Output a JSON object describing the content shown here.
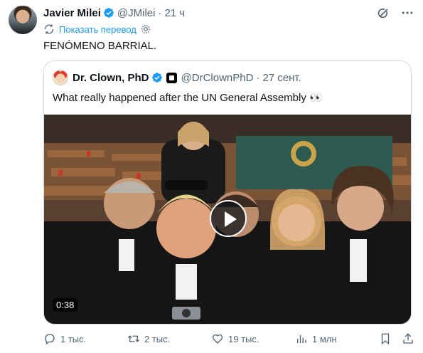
{
  "tweet": {
    "author": {
      "name": "Javier Milei",
      "handle": "@JMilei",
      "time": "21 ч",
      "verified": true
    },
    "translate_label": "Показать перевод",
    "text": "FENÓMENO BARRIAL.",
    "quote": {
      "author": {
        "name": "Dr. Clown, PhD",
        "handle": "@DrClownPhD",
        "date": "27 сент.",
        "verified": true
      },
      "text": "What really happened after the UN General Assembly 👀",
      "media": {
        "type": "video",
        "duration": "0:38"
      }
    },
    "stats": {
      "replies": "1 тыс.",
      "retweets": "2 тыс.",
      "likes": "19 тыс.",
      "views": "1 млн"
    }
  },
  "icons": [
    "grok-icon",
    "more-icon",
    "translate-icon",
    "settings-icon",
    "reply-icon",
    "retweet-icon",
    "like-icon",
    "views-icon",
    "bookmark-icon",
    "share-icon"
  ],
  "colors": {
    "accent": "#1d9bf0",
    "secondary_text": "#536471",
    "border": "#cfd9de"
  }
}
